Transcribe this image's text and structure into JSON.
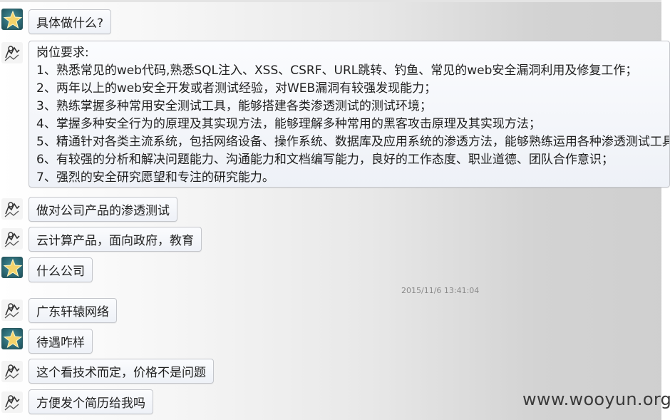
{
  "messages": [
    {
      "sender": "star",
      "text": "具体做什么?"
    },
    {
      "sender": "sketch",
      "lines": [
        "岗位要求:",
        "1、熟悉常见的web代码,熟悉SQL注入、XSS、CSRF、URL跳转、钓鱼、常见的web安全漏洞利用及修复工作；",
        "2、两年以上的web安全开发或者测试经验，对WEB漏洞有较强发现能力；",
        "3、熟练掌握多种常用安全测试工具，能够搭建各类渗透测试的测试环境；",
        "4、掌握多种安全行为的原理及其实现方法，能够理解多种常用的黑客攻击原理及其实现方法；",
        "5、精通针对各类主流系统，包括网络设备、操作系统、数据库及应用系统的渗透方法，能够熟练运用各种渗透测试工具；",
        "6、有较强的分析和解决问题能力、沟通能力和文档编写能力，良好的工作态度、职业道德、团队合作意识；",
        "7、强烈的安全研究愿望和专注的研究能力。"
      ]
    },
    {
      "sender": "sketch",
      "text": "做对公司产品的渗透测试"
    },
    {
      "sender": "sketch",
      "text": "云计算产品，面向政府，教育"
    },
    {
      "sender": "star",
      "text": "什么公司"
    },
    {
      "sender": "sketch",
      "text": "广东轩辕网络"
    },
    {
      "sender": "star",
      "text": "待遇咋样"
    },
    {
      "sender": "sketch",
      "text": "这个看技术而定，价格不是问题"
    },
    {
      "sender": "sketch",
      "text": "方便发个简历给我吗"
    }
  ],
  "timestamp": "2015/11/6 13:41:04",
  "watermark": "www.wooyun.org",
  "avatars": {
    "star": "star-icon",
    "sketch": "sketch-figure-icon"
  },
  "colors": {
    "bubble_border": "#c4c6cb",
    "bubble_bg": "#eef1f7",
    "star_bg": "#2f6e79",
    "star": "#f4d36a"
  }
}
